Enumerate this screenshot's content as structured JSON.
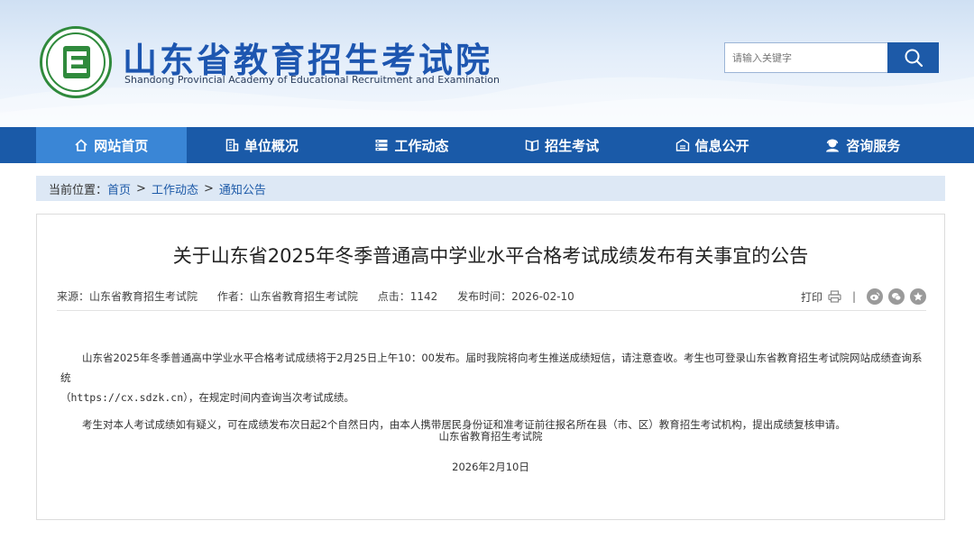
{
  "header": {
    "title_cn": "山东省教育招生考试院",
    "title_en": "Shandong Provincial Academy of Educational Recruitment and Examination",
    "logo_icon": "institution-emblem-icon",
    "brand_color": "#1d56b0"
  },
  "search": {
    "placeholder": "请输入关键字",
    "button_icon": "search-icon"
  },
  "nav": {
    "items": [
      {
        "label": "网站首页",
        "icon": "home-icon",
        "active": true
      },
      {
        "label": "单位概况",
        "icon": "building-icon",
        "active": false
      },
      {
        "label": "工作动态",
        "icon": "news-icon",
        "active": false
      },
      {
        "label": "招生考试",
        "icon": "book-icon",
        "active": false
      },
      {
        "label": "信息公开",
        "icon": "info-icon",
        "active": false
      },
      {
        "label": "咨询服务",
        "icon": "user-service-icon",
        "active": false
      }
    ],
    "bg_color": "#1a5aa8",
    "active_color": "#3a86d6"
  },
  "breadcrumb": {
    "prefix": "当前位置：",
    "items": [
      "首页",
      "工作动态",
      "通知公告"
    ],
    "separator": ">"
  },
  "article": {
    "title": "关于山东省2025年冬季普通高中学业水平合格考试成绩发布有关事宜的公告",
    "source": "来源：山东省教育招生考试院",
    "author": "作者：山东省教育招生考试院",
    "clicks": "点击：1142",
    "publish_time": "发布时间：2026-02-10",
    "print_label": "打印",
    "share_icons": [
      "weibo-icon",
      "wechat-icon",
      "favorite-icon"
    ],
    "para1_a": "山东省2025年冬季普通高中学业水平合格考试成绩将于2月25日上午10：00发布。届时我院将向考生推送成绩短信，请注意查收。考生也可登录山东省教育招生考试院网站成绩查询系统",
    "para1_b": "（https://cx.sdzk.cn），在规定时间内查询当次考试成绩。",
    "para2": "考生对本人考试成绩如有疑义，可在成绩发布次日起2个自然日内，由本人携带居民身份证和准考证前往报名所在县（市、区）教育招生考试机构，提出成绩复核申请。",
    "signature": "山东省教育招生考试院",
    "date": "2026年2月10日"
  }
}
